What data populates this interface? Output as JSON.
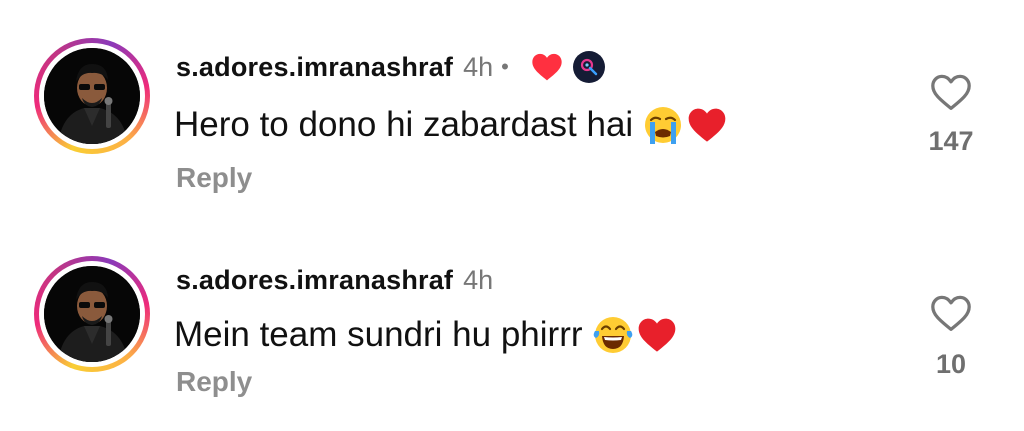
{
  "comments": [
    {
      "username": "s.adores.imranashraf",
      "timestamp": "4h",
      "separator": "•",
      "creator_liked": true,
      "text": "Hero to dono hi zabardast hai",
      "emojis": [
        "loudly-crying-face",
        "red-heart"
      ],
      "reply_label": "Reply",
      "like_count": "147"
    },
    {
      "username": "s.adores.imranashraf",
      "timestamp": "4h",
      "creator_liked": false,
      "text": "Mein team sundri hu phirrr",
      "emojis": [
        "tears-of-joy-face",
        "red-heart"
      ],
      "reply_label": "Reply",
      "like_count": "10"
    }
  ],
  "colors": {
    "heart_red": "#ff3040",
    "muted_text": "#8e8e8e",
    "badge_bg": "#151c35"
  }
}
